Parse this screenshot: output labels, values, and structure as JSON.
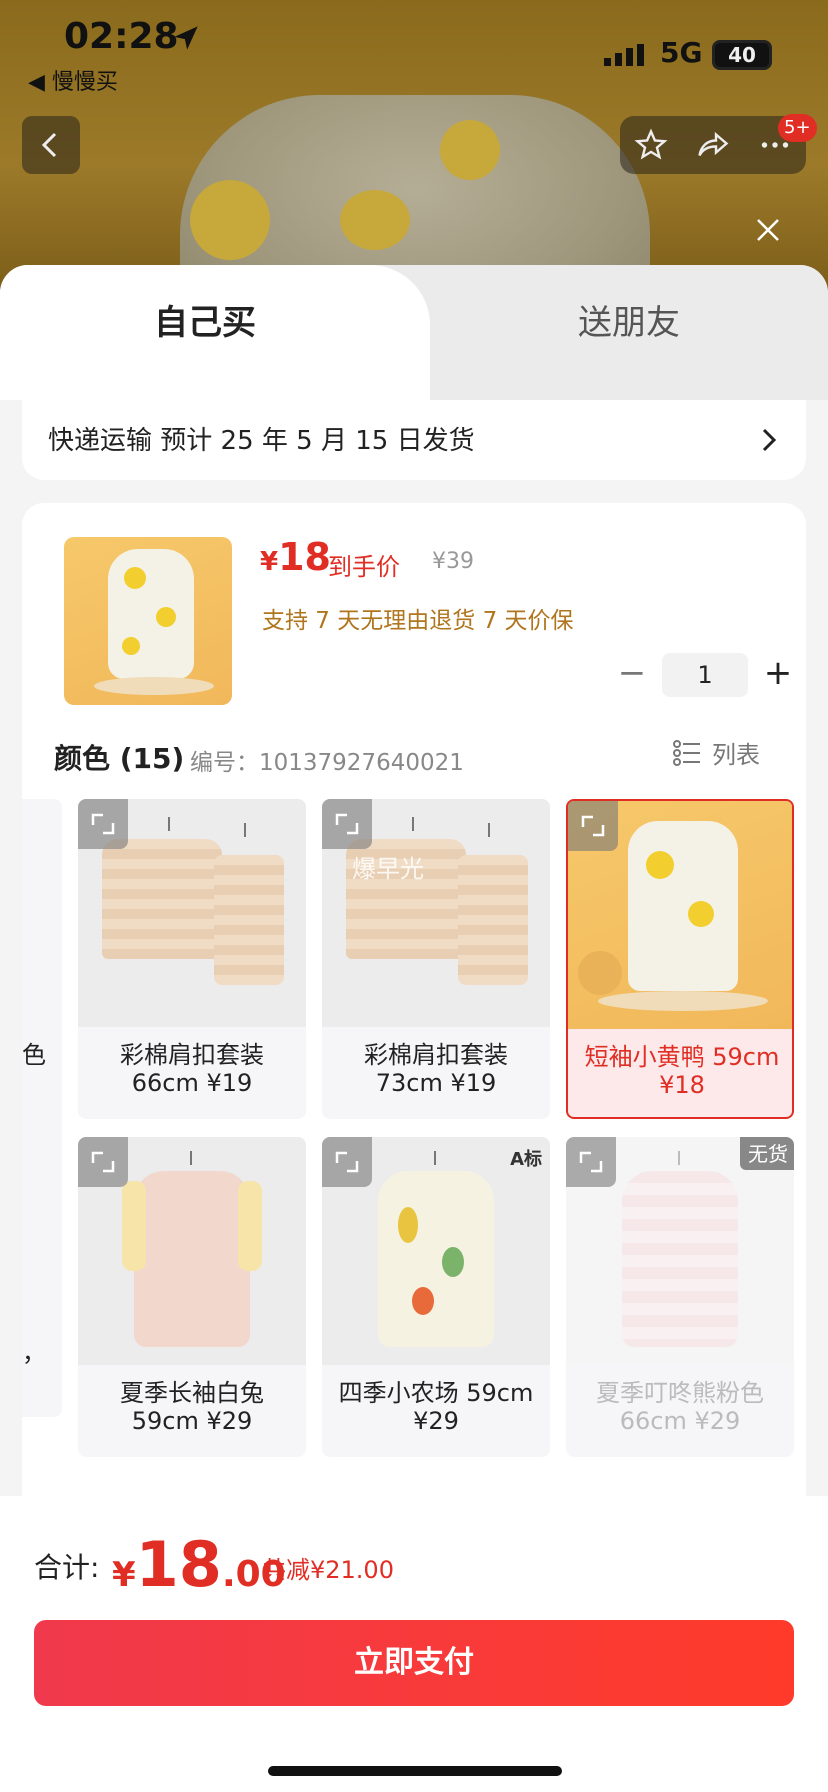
{
  "status_bar": {
    "time": "02:28",
    "back_app": "◀ 慢慢买",
    "network": "5G",
    "battery": "40"
  },
  "nav": {
    "badge": "5+"
  },
  "tabs": {
    "self_buy": "自己买",
    "send_friend": "送朋友"
  },
  "shipping": {
    "text": "快递运输 预计 25 年 5 月 15 日发货"
  },
  "product": {
    "currency": "¥",
    "price": "18",
    "price_label": "到手价",
    "original_price": "¥39",
    "promise": "支持 7 天无理由退货   7 天价保",
    "quantity": "1",
    "minus": "−",
    "plus": "+"
  },
  "color_section": {
    "title": "颜色 (15)",
    "code": "编号：10137927640021",
    "list_label": "列表"
  },
  "variants": [
    {
      "line1": "彩棉肩扣套装",
      "line2": "66cm ¥19",
      "state": "normal"
    },
    {
      "line1": "彩棉肩扣套装",
      "line2": "73cm ¥19",
      "state": "normal"
    },
    {
      "line1": "短袖小黄鸭 59cm",
      "line2": "¥18",
      "state": "selected"
    },
    {
      "line1": "夏季长袖白兔",
      "line2": "59cm ¥29",
      "state": "normal"
    },
    {
      "line1": "四季小农场 59cm",
      "line2": "¥29",
      "state": "normal",
      "badge": "A标"
    },
    {
      "line1": "夏季叮咚熊粉色",
      "line2": "66cm ¥29",
      "state": "out",
      "badge": "无货"
    }
  ],
  "partial_labels": {
    "row1": "色",
    "row2": "，"
  },
  "watermark": "爆早光",
  "bottom": {
    "total_label": "合计:",
    "currency": "¥",
    "total_int": "18",
    "total_dec": ".00",
    "discount": "共减¥21.00",
    "pay_button": "立即支付"
  },
  "colors": {
    "accent": "#e02e24",
    "pay_gradient_start": "#f0394c",
    "pay_gradient_end": "#ff3a2a",
    "promise": "#b0761e"
  }
}
